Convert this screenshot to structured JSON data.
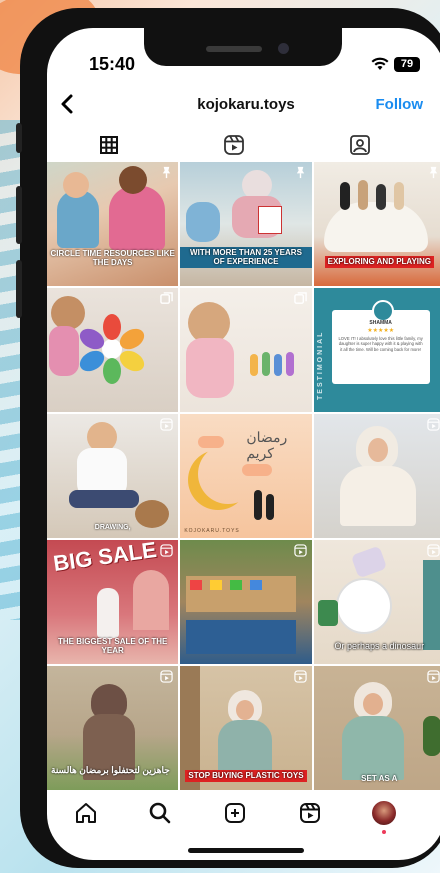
{
  "status_bar": {
    "time": "15:40",
    "battery": "79"
  },
  "header": {
    "username": "kojokaru.toys",
    "follow_label": "Follow"
  },
  "tabs": [
    "grid-icon",
    "reels-icon",
    "tagged-icon"
  ],
  "posts": [
    {
      "caption": "CIRCLE TIME RESOURCES LIKE THE DAYS",
      "type": "pinned"
    },
    {
      "caption": "WITH MORE THAN 25 YEARS OF EXPERIENCE",
      "type": "pinned"
    },
    {
      "caption": "EXPLORING AND PLAYING",
      "type": "pinned"
    },
    {
      "caption": "",
      "type": "carousel"
    },
    {
      "caption": "",
      "type": "carousel"
    },
    {
      "testimonial_label": "TESTIMONIAL",
      "reviewer": "SHAMMA",
      "stars": 5,
      "review": "LOVE IT! I absolutely love this little family, my daughter is super happy with it & playing with it all the time. Will be coming back for more!",
      "type": "photo"
    },
    {
      "caption": "DRAWING,",
      "type": "reel"
    },
    {
      "brand": "KOJOKARU.TOYS",
      "type": "photo"
    },
    {
      "caption": "",
      "type": "reel"
    },
    {
      "big_text": "BIG SALE",
      "caption": "THE BIGGEST SALE OF THE YEAR",
      "type": "reel"
    },
    {
      "caption": "",
      "type": "reel"
    },
    {
      "caption": "Or perhaps a dinosaur",
      "type": "reel"
    },
    {
      "caption": "جاهزين لتحتفلوا برمضان هالسنة",
      "type": "reel"
    },
    {
      "caption": "STOP BUYING PLASTIC TOYS",
      "type": "reel"
    },
    {
      "caption": "SET AS A",
      "type": "reel"
    }
  ],
  "bottom_nav": [
    "home-icon",
    "search-icon",
    "create-icon",
    "reels-icon",
    "profile-avatar"
  ],
  "colors": {
    "follow": "#1a8cf0",
    "accent_red": "#d22",
    "teal": "#1f6a8f"
  }
}
